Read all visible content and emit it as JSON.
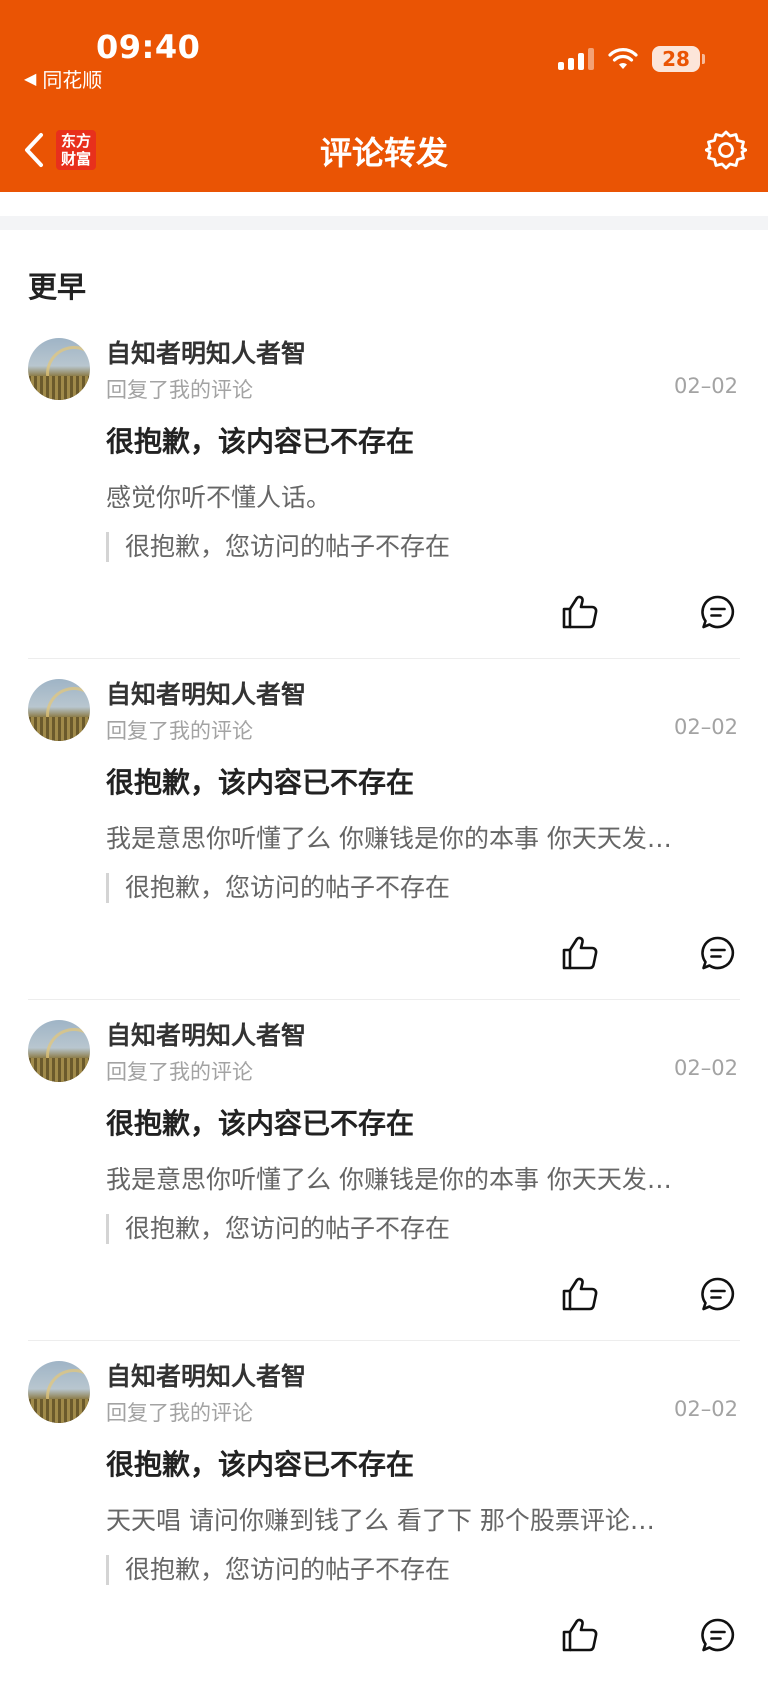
{
  "status_bar": {
    "time": "09:40",
    "back_app": "同花顺",
    "battery": "28"
  },
  "nav": {
    "logo_line1": "东方",
    "logo_line2": "财富",
    "title": "评论转发"
  },
  "section_title": "更早",
  "items": [
    {
      "username": "自知者明知人者智",
      "action": "回复了我的评论",
      "date": "02–02",
      "headline": "很抱歉，该内容已不存在",
      "content": "感觉你听不懂人话。",
      "quote": "很抱歉，您访问的帖子不存在"
    },
    {
      "username": "自知者明知人者智",
      "action": "回复了我的评论",
      "date": "02–02",
      "headline": "很抱歉，该内容已不存在",
      "content": "我是意思你听懂了么  你赚钱是你的本事  你天天发…",
      "quote": "很抱歉，您访问的帖子不存在"
    },
    {
      "username": "自知者明知人者智",
      "action": "回复了我的评论",
      "date": "02–02",
      "headline": "很抱歉，该内容已不存在",
      "content": "我是意思你听懂了么  你赚钱是你的本事  你天天发…",
      "quote": "很抱歉，您访问的帖子不存在"
    },
    {
      "username": "自知者明知人者智",
      "action": "回复了我的评论",
      "date": "02–02",
      "headline": "很抱歉，该内容已不存在",
      "content": "天天唱   请问你赚到钱了么  看了下 那个股票评论…",
      "quote": "很抱歉，您访问的帖子不存在"
    }
  ],
  "icons": {
    "back": "chevron-left-icon",
    "settings": "gear-icon",
    "like": "thumbs-up-icon",
    "reply": "comment-bubble-icon"
  },
  "colors": {
    "brand": "#ea5404",
    "logo": "#e8301c"
  }
}
